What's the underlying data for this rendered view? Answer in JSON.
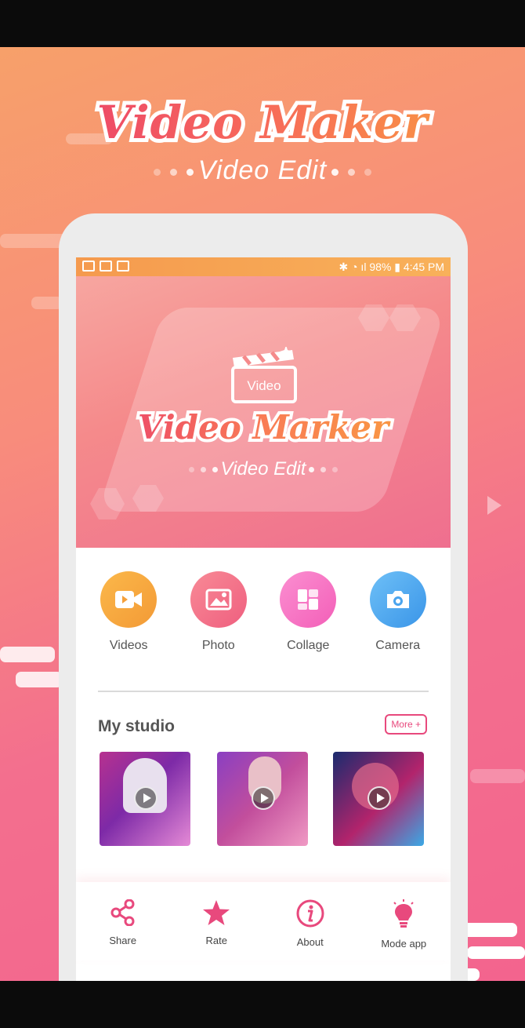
{
  "promo": {
    "title": "Video Maker",
    "subtitle": "Video Edit"
  },
  "status_bar": {
    "battery": "98%",
    "time": "4:45 PM"
  },
  "hero": {
    "clapper_label": "Video",
    "title": "Video Marker",
    "subtitle": "Video Edit"
  },
  "actions": [
    {
      "label": "Videos",
      "icon": "video-camera-icon",
      "color": "#f7a23e"
    },
    {
      "label": "Photo",
      "icon": "image-icon",
      "color": "#f46f88"
    },
    {
      "label": "Collage",
      "icon": "collage-icon",
      "color": "#f76cc3"
    },
    {
      "label": "Camera",
      "icon": "camera-icon",
      "color": "#4aa4ee"
    }
  ],
  "studio": {
    "title": "My studio",
    "more_label": "More +"
  },
  "bottom_nav": [
    {
      "label": "Share",
      "icon": "share-icon"
    },
    {
      "label": "Rate",
      "icon": "star-icon"
    },
    {
      "label": "About",
      "icon": "info-icon"
    },
    {
      "label": "Mode app",
      "icon": "lightbulb-icon"
    }
  ],
  "colors": {
    "accent": "#e8497d",
    "orange": "#f9a23c"
  }
}
